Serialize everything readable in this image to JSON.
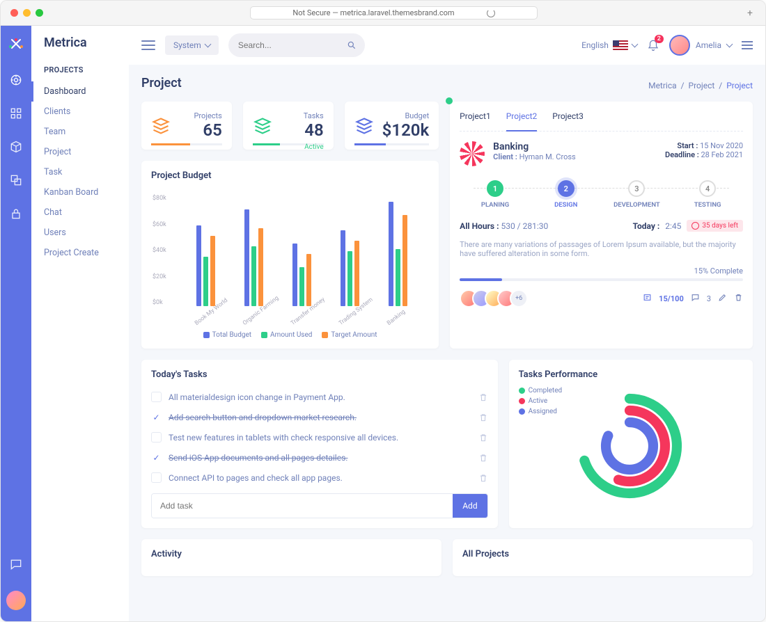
{
  "browser": {
    "url": "Not Secure — metrica.laravel.themesbrand.com"
  },
  "brand": "Metrica",
  "topbar": {
    "system_label": "System",
    "search_placeholder": "Search...",
    "language": "English",
    "bell_badge": "2",
    "user_name": "Amelia"
  },
  "sidebar": {
    "heading": "PROJECTS",
    "items": [
      {
        "label": "Dashboard",
        "active": true
      },
      {
        "label": "Clients"
      },
      {
        "label": "Team"
      },
      {
        "label": "Project"
      },
      {
        "label": "Task"
      },
      {
        "label": "Kanban Board"
      },
      {
        "label": "Chat"
      },
      {
        "label": "Users"
      },
      {
        "label": "Project Create"
      }
    ]
  },
  "page": {
    "title": "Project",
    "crumbs": [
      "Metrica",
      "Project",
      "Project"
    ]
  },
  "stats": [
    {
      "label": "Projects",
      "value": "65",
      "color": "#fb923c",
      "bar_pct": 55
    },
    {
      "label": "Tasks",
      "value": "48",
      "color": "#2dce89",
      "bar_pct": 38,
      "tag": "Active"
    },
    {
      "label": "Budget",
      "value": "$120k",
      "color": "#5e72e4",
      "bar_pct": 42
    }
  ],
  "chart_data": {
    "type": "bar",
    "title": "Project Budget",
    "ylabel": "",
    "xlabel": "",
    "ylim": [
      0,
      80
    ],
    "yticks": [
      "$0k",
      "$20k",
      "$40k",
      "$60k",
      "$80k"
    ],
    "categories": [
      "Book My World",
      "Organic Farming",
      "Transfer money",
      "Trading System",
      "Banking"
    ],
    "series": [
      {
        "name": "Total Budget",
        "color": "#5e72e4",
        "values": [
          62,
          74,
          48,
          58,
          80
        ]
      },
      {
        "name": "Amount Used",
        "color": "#2dce89",
        "values": [
          38,
          46,
          30,
          42,
          44
        ]
      },
      {
        "name": "Target Amount",
        "color": "#fb923c",
        "values": [
          54,
          60,
          40,
          50,
          70
        ]
      }
    ]
  },
  "project_tabs": [
    "Project1",
    "Project2",
    "Project3"
  ],
  "project_active_tab": 1,
  "project": {
    "name": "Banking",
    "client_label": "Client :",
    "client": "Hyman M. Cross",
    "start_label": "Start :",
    "start": "15 Nov 2020",
    "deadline_label": "Deadline :",
    "deadline": "28 Feb 2021",
    "steps": [
      {
        "n": "1",
        "label": "PLANING",
        "state": "done"
      },
      {
        "n": "2",
        "label": "DESIGN",
        "state": "cur"
      },
      {
        "n": "3",
        "label": "DEVELOPMENT",
        "state": ""
      },
      {
        "n": "4",
        "label": "TESTING",
        "state": ""
      }
    ],
    "hours_label": "All Hours :",
    "hours": "530 / 281:30",
    "today_label": "Today :",
    "today": "2:45",
    "days_left": "35 days left",
    "desc": "There are many variations of passages of Lorem Ipsum available, but the majority have suffered alteration in some form.",
    "complete_label": "15% Complete",
    "complete_pct": 15,
    "avatars_more": "+6",
    "tasks_done": "15/100",
    "comments": "3"
  },
  "tasks_card": {
    "title": "Today's Tasks",
    "items": [
      {
        "text": "All materialdesign icon change in Payment App.",
        "done": false
      },
      {
        "text": "Add search button and dropdown market research.",
        "done": true
      },
      {
        "text": "Test new features in tablets with check responsive all devices.",
        "done": false
      },
      {
        "text": "Send iOS App documents and all pages detailes.",
        "done": true
      },
      {
        "text": "Connect API to pages and check all app pages.",
        "done": false
      }
    ],
    "add_placeholder": "Add task",
    "add_button": "Add"
  },
  "performance": {
    "title": "Tasks Performance",
    "series": [
      {
        "label": "Completed",
        "color": "#2dce89",
        "pct": 70
      },
      {
        "label": "Active",
        "color": "#f5365c",
        "pct": 55
      },
      {
        "label": "Assigned",
        "color": "#5e72e4",
        "pct": 82
      }
    ]
  },
  "bottom": {
    "activity": "Activity",
    "all_projects": "All Projects"
  }
}
